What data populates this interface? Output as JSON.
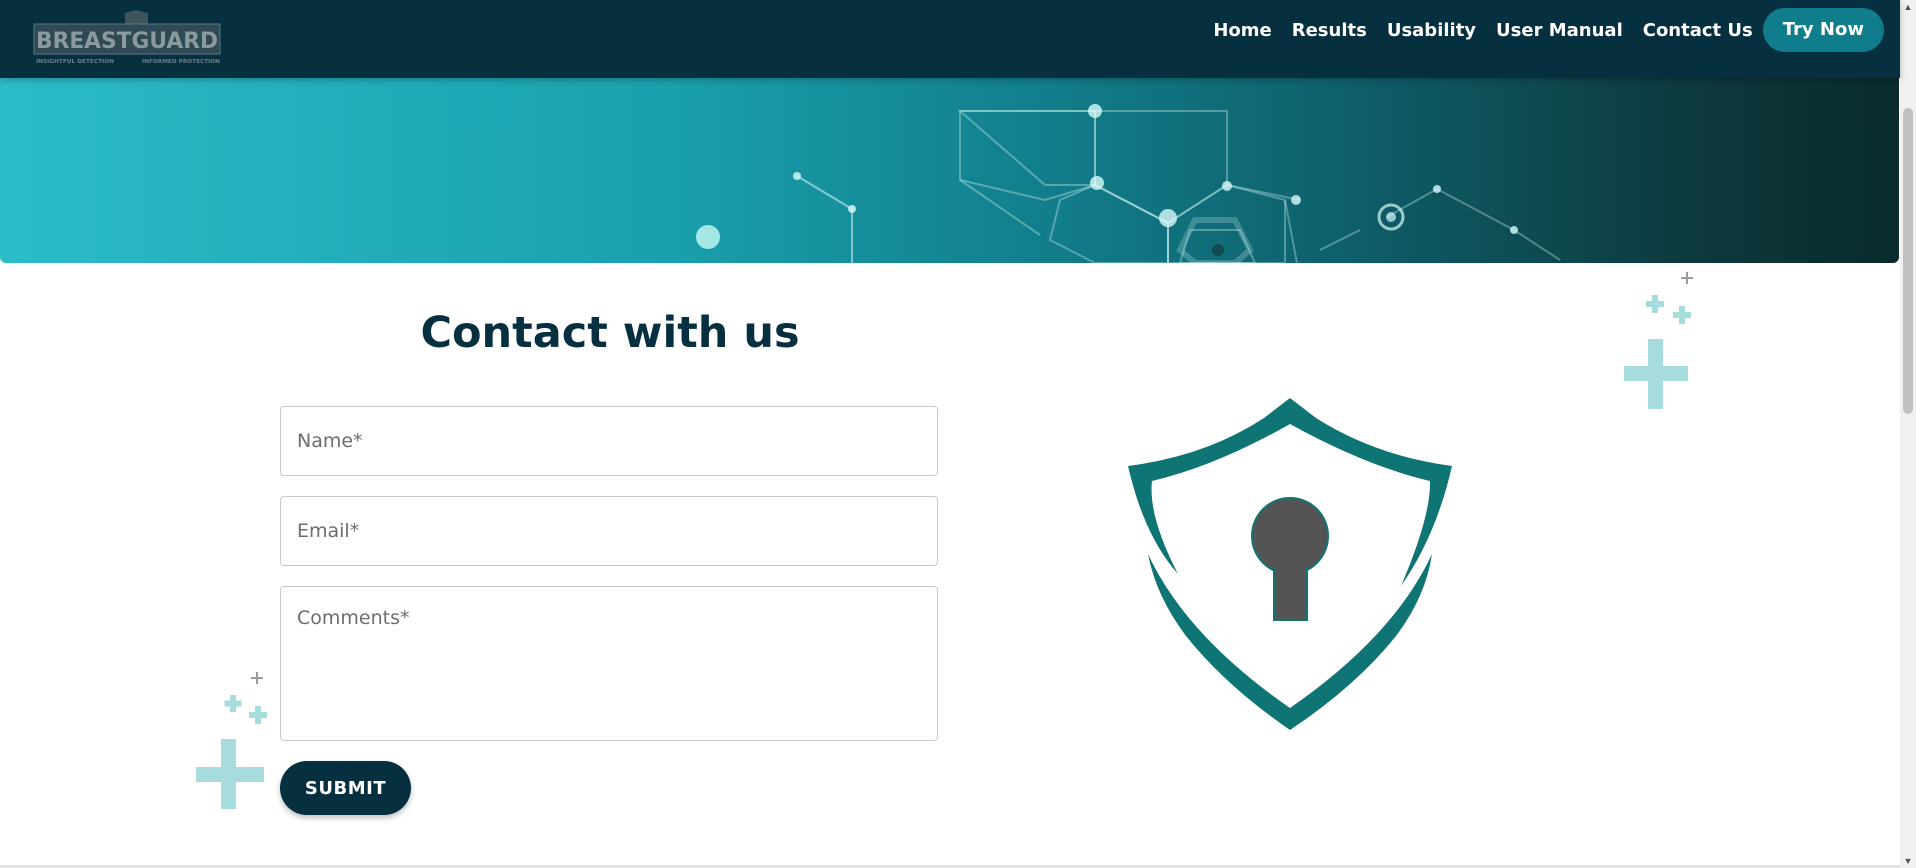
{
  "brand": {
    "logo_text": "BREASTGUARD",
    "logo_tagline_left": "INSIGHTFUL DETECTION",
    "logo_tagline_right": "INFORMED PROTECTION"
  },
  "nav": {
    "items": [
      {
        "label": "Home"
      },
      {
        "label": "Results"
      },
      {
        "label": "Usability"
      },
      {
        "label": "User Manual"
      },
      {
        "label": "Contact Us"
      }
    ],
    "cta_label": "Try Now"
  },
  "contact": {
    "title": "Contact with us",
    "name_placeholder": "Name*",
    "email_placeholder": "Email*",
    "comments_placeholder": "Comments*",
    "submit_label": "SUBMIT"
  },
  "icons": {
    "shield": "shield-keyhole-icon",
    "plus": "plus-icon"
  },
  "colors": {
    "header_bg": "#062f3f",
    "accent": "#0f7d8c",
    "shield": "#0e7474",
    "keyhole": "#545454",
    "decor_plus": "#a6dcdb"
  }
}
